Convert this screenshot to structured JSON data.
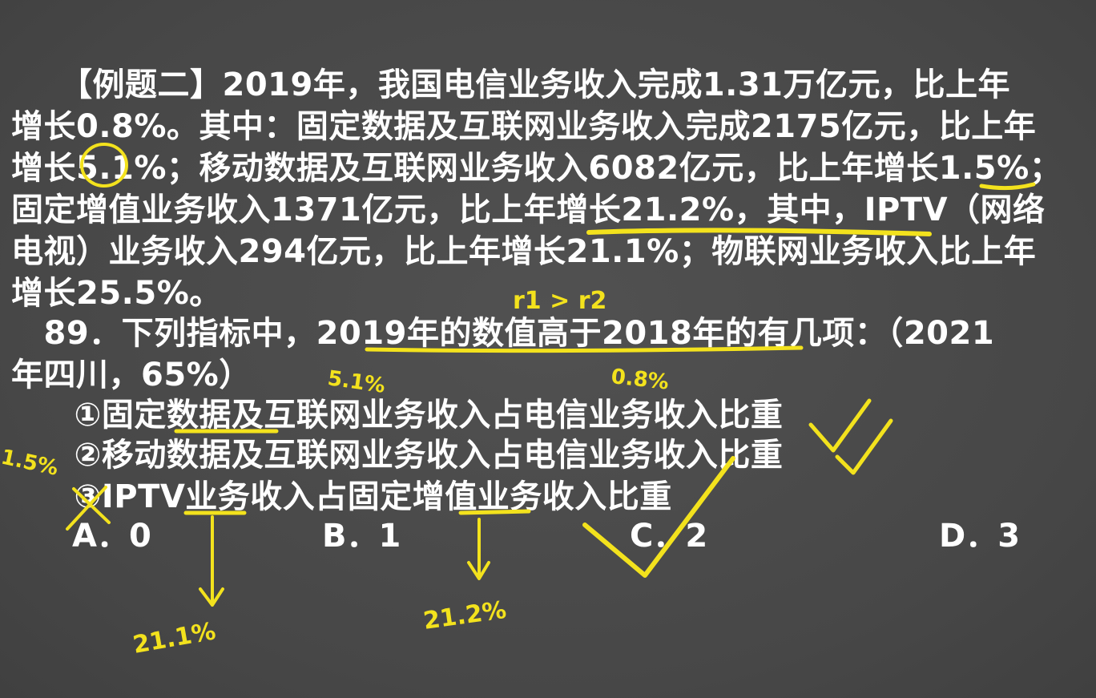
{
  "passage": {
    "lines": [
      "　　【例题二】2019年，我国电信业务收入完成1.31万亿元，比上年",
      "增长0.8%。其中：固定数据及互联网业务收入完成2175亿元，比上年",
      "增长5.1%；移动数据及互联网业务收入6082亿元，比上年增长1.5%；",
      "固定增值业务收入1371亿元，比上年增长21.2%，其中，IPTV（网络",
      "电视）业务收入294亿元，比上年增长21.1%；物联网业务收入比上年",
      "增长25.5%。"
    ]
  },
  "question": {
    "line1": "　89．下列指标中，2019年的数值高于2018年的有几项：（2021",
    "line2": "年四川，65%）",
    "items": [
      "　①固定数据及互联网业务收入占电信业务收入比重",
      "　②移动数据及互联网业务收入占电信业务收入比重",
      "　③IPTV业务收入占固定增值业务收入比重"
    ],
    "options": [
      "A．0",
      "B．1",
      "C．2",
      "D．3"
    ]
  },
  "annotations": {
    "note_top": "r1 > r2",
    "note_item1_left": "5.1%",
    "note_item1_right": "0.8%",
    "note_item2_left": "1.5%",
    "note_bottom_left": "21.1%",
    "note_bottom_right": "21.2%",
    "ink_color": "#f3e21d"
  },
  "colors": {
    "background": "#4a4a4a",
    "text": "#ffffff"
  }
}
